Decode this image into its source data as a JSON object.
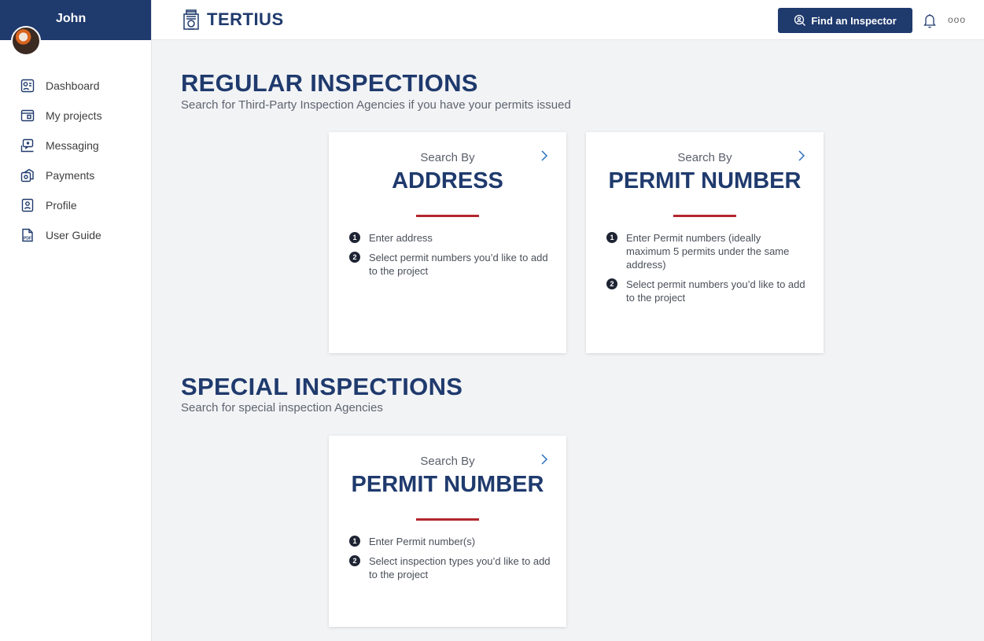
{
  "user": {
    "name": "John"
  },
  "sidebar": {
    "items": [
      {
        "label": "Dashboard",
        "icon": "dashboard-icon"
      },
      {
        "label": "My projects",
        "icon": "projects-icon"
      },
      {
        "label": "Messaging",
        "icon": "messaging-icon"
      },
      {
        "label": "Payments",
        "icon": "payments-icon"
      },
      {
        "label": "Profile",
        "icon": "profile-icon"
      },
      {
        "label": "User Guide",
        "icon": "pdf-icon"
      }
    ]
  },
  "header": {
    "logo_text": "TERTIUS",
    "find_inspector_label": "Find an Inspector",
    "more_label": "ooo"
  },
  "regular": {
    "title": "REGULAR INSPECTIONS",
    "subtitle": "Search for Third-Party Inspection Agencies if you have your permits issued",
    "cards": [
      {
        "pre": "Search By",
        "title": "ADDRESS",
        "steps": [
          "Enter address",
          "Select permit numbers you’d like to add to the project"
        ]
      },
      {
        "pre": "Search By",
        "title": "PERMIT NUMBER",
        "steps": [
          "Enter Permit numbers (ideally maximum 5 permits under the same address)",
          "Select permit numbers you’d like to add to the project"
        ]
      }
    ]
  },
  "special": {
    "title": "SPECIAL INSPECTIONS",
    "subtitle": "Search for special inspection Agencies",
    "cards": [
      {
        "pre": "Search By",
        "title": "PERMIT NUMBER",
        "steps": [
          "Enter Permit number(s)",
          "Select inspection types you’d like to add to the project"
        ]
      }
    ]
  },
  "step_numbers": [
    "1",
    "2"
  ],
  "colors": {
    "brand": "#1f3a6d",
    "accent": "#b3262d",
    "background": "#f2f3f5"
  }
}
